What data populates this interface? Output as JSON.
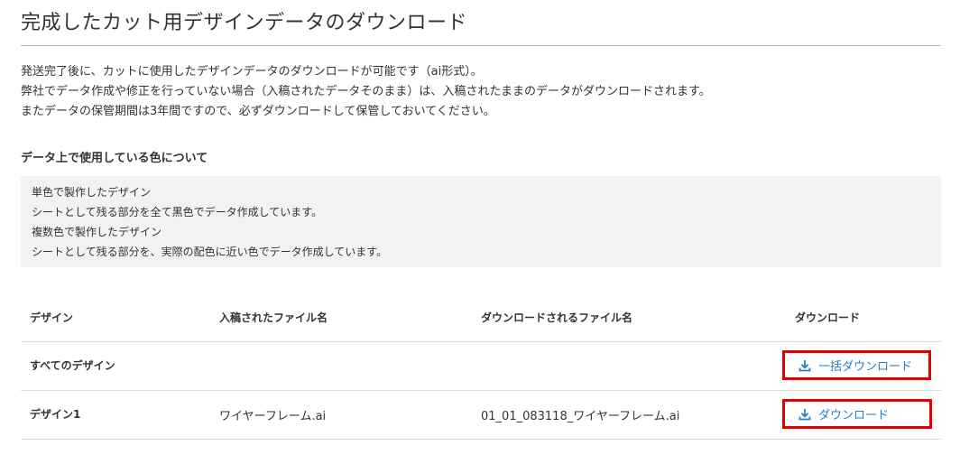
{
  "page": {
    "title": "完成したカット用デザインデータのダウンロード"
  },
  "intro": {
    "lines": [
      "発送完了後に、カットに使用したデザインデータのダウンロードが可能です（ai形式）。",
      "弊社でデータ作成や修正を行っていない場合（入稿されたデータそのまま）は、入稿されたままのデータがダウンロードされます。",
      "またデータの保管期間は3年間ですので、必ずダウンロードして保管しておいてください。"
    ]
  },
  "colors_section": {
    "heading": "データ上で使用している色について",
    "lines": [
      "単色で製作したデザイン",
      "シートとして残る部分を全て黒色でデータ作成しています。",
      "複数色で製作したデザイン",
      "シートとして残る部分を、実際の配色に近い色でデータ作成しています。"
    ]
  },
  "table": {
    "headers": [
      "デザイン",
      "入稿されたファイル名",
      "ダウンロードされるファイル名",
      "ダウンロード"
    ],
    "rows": [
      {
        "design": "すべてのデザイン",
        "uploaded": "",
        "download_name": "",
        "action": "一括ダウンロード"
      },
      {
        "design": "デザイン1",
        "uploaded": "ワイヤーフレーム.ai",
        "download_name": "01_01_083118_ワイヤーフレーム.ai",
        "action": "ダウンロード"
      }
    ]
  },
  "colors": {
    "link": "#2a7ec5",
    "highlight_border": "#e00000",
    "box_bg": "#f2f2f2"
  },
  "icons": {
    "download": "download-icon"
  }
}
